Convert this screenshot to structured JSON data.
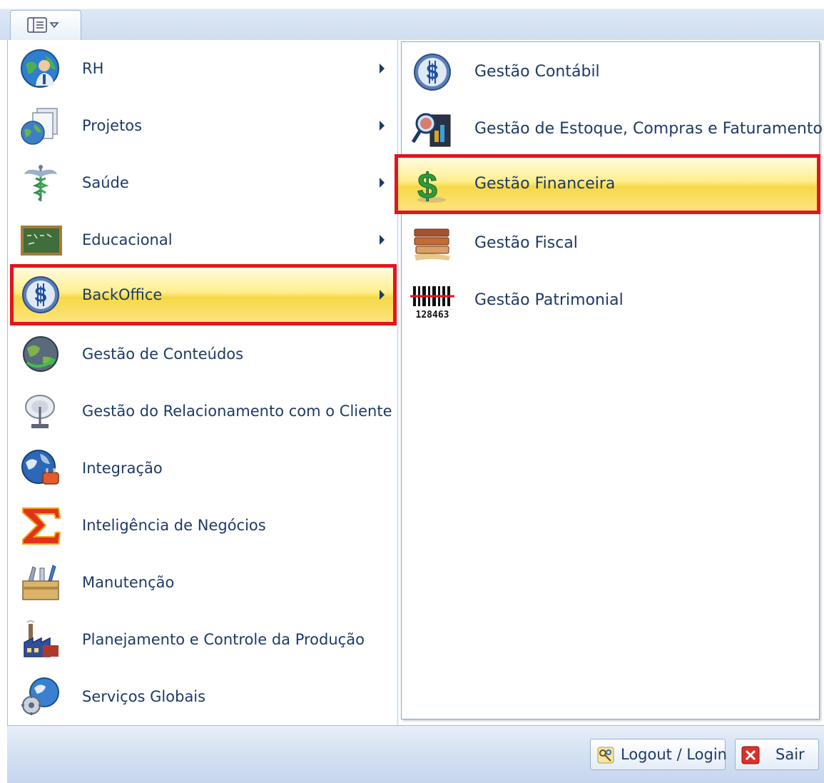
{
  "left_menu": {
    "items": [
      {
        "label": "RH",
        "icon": "person-globe-icon",
        "has_submenu": true
      },
      {
        "label": "Projetos",
        "icon": "globe-documents-icon",
        "has_submenu": true
      },
      {
        "label": "Saúde",
        "icon": "caduceus-icon",
        "has_submenu": true
      },
      {
        "label": "Educacional",
        "icon": "chalkboard-icon",
        "has_submenu": true
      },
      {
        "label": "BackOffice",
        "icon": "dollar-coin-icon",
        "has_submenu": true,
        "selected": true
      },
      {
        "label": "Gestão de Conteúdos",
        "icon": "globe-arrows-icon",
        "has_submenu": false
      },
      {
        "label": "Gestão do Relacionamento com o Cliente",
        "icon": "satellite-dish-icon",
        "has_submenu": false
      },
      {
        "label": "Integração",
        "icon": "globe-plug-icon",
        "has_submenu": false
      },
      {
        "label": "Inteligência de Negócios",
        "icon": "sigma-icon",
        "has_submenu": false
      },
      {
        "label": "Manutenção",
        "icon": "toolbox-icon",
        "has_submenu": false
      },
      {
        "label": "Planejamento e Controle da Produção",
        "icon": "factory-icon",
        "has_submenu": false
      },
      {
        "label": "Serviços Globais",
        "icon": "globe-gears-icon",
        "has_submenu": false
      }
    ]
  },
  "submenu": {
    "items": [
      {
        "label": "Gestão Contábil",
        "icon": "dollar-coin-icon"
      },
      {
        "label": "Gestão de Estoque, Compras e Faturamento",
        "icon": "magnifier-document-icon"
      },
      {
        "label": "Gestão Financeira",
        "icon": "green-dollar-icon",
        "selected": true
      },
      {
        "label": "Gestão Fiscal",
        "icon": "books-icon"
      },
      {
        "label": "Gestão Patrimonial",
        "icon": "barcode-icon",
        "barcode_text": "128463"
      }
    ]
  },
  "bottom_bar": {
    "logout_label": "Logout / Login",
    "exit_label": "Sair"
  },
  "colors": {
    "highlight_border": "#e2141f",
    "selection_gold": "#f6d848",
    "text": "#1e3a66"
  }
}
